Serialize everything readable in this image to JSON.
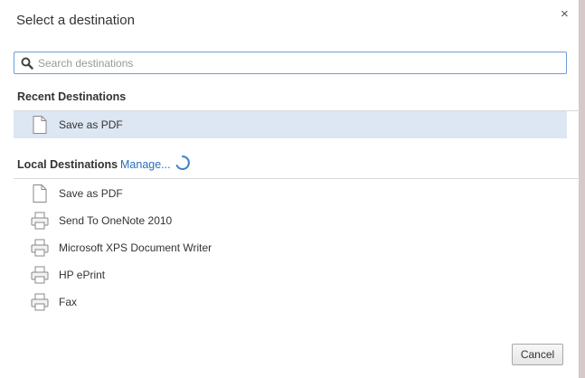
{
  "dialog": {
    "title": "Select a destination",
    "close_glyph": "×"
  },
  "search": {
    "placeholder": "Search destinations",
    "value": "",
    "icon": "search-icon"
  },
  "recent": {
    "heading": "Recent Destinations",
    "items": [
      {
        "label": "Save as PDF",
        "icon": "document-icon",
        "selected": true
      }
    ]
  },
  "local": {
    "heading": "Local Destinations",
    "manage_label": "Manage...",
    "loading": true,
    "items": [
      {
        "label": "Save as PDF",
        "icon": "document-icon"
      },
      {
        "label": "Send To OneNote 2010",
        "icon": "printer-icon"
      },
      {
        "label": "Microsoft XPS Document Writer",
        "icon": "printer-icon"
      },
      {
        "label": "HP ePrint",
        "icon": "printer-icon"
      },
      {
        "label": "Fax",
        "icon": "printer-icon"
      }
    ]
  },
  "footer": {
    "cancel_label": "Cancel"
  },
  "colors": {
    "link": "#2a6ebb",
    "selected_row": "#dde6f3",
    "focus_border": "#6a9fd6"
  }
}
